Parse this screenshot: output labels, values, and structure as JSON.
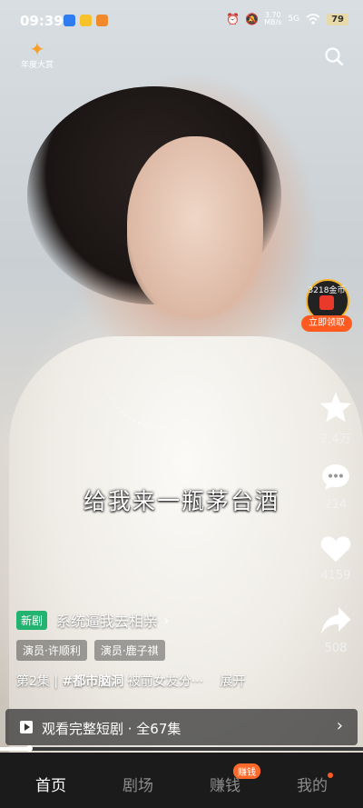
{
  "status_bar": {
    "time": "09:39",
    "network_speed": "3.70",
    "speed_unit": "MB/s",
    "network_type": "5G",
    "battery": "79"
  },
  "header": {
    "logo_text": "年度大赏"
  },
  "video": {
    "subtitle": "给我来一瓶茅台酒"
  },
  "reward": {
    "coins_label": "3218金币",
    "cta": "立即领取"
  },
  "actions": {
    "favorite_count": "2.4万",
    "comment_count": "214",
    "like_count": "4159",
    "share_count": "508"
  },
  "series": {
    "badge": "新剧",
    "title": "系统逼我去相亲",
    "cast": [
      "演员·许顺利",
      "演员·鹿子祺"
    ],
    "episode_text": "第2集 |",
    "hashtag": "#都市脑洞",
    "description": "被前女友分···",
    "expand": "展开",
    "watch_full": "观看完整短剧 · 全67集",
    "progress_fraction": 0.08
  },
  "nav": {
    "items": [
      "首页",
      "剧场",
      "赚钱",
      "我的"
    ],
    "earn_badge": "赚钱"
  },
  "colors": {
    "accent": "#ff5a1f",
    "new_badge": "#21b36f",
    "coin_ring": "#f5b52b"
  }
}
